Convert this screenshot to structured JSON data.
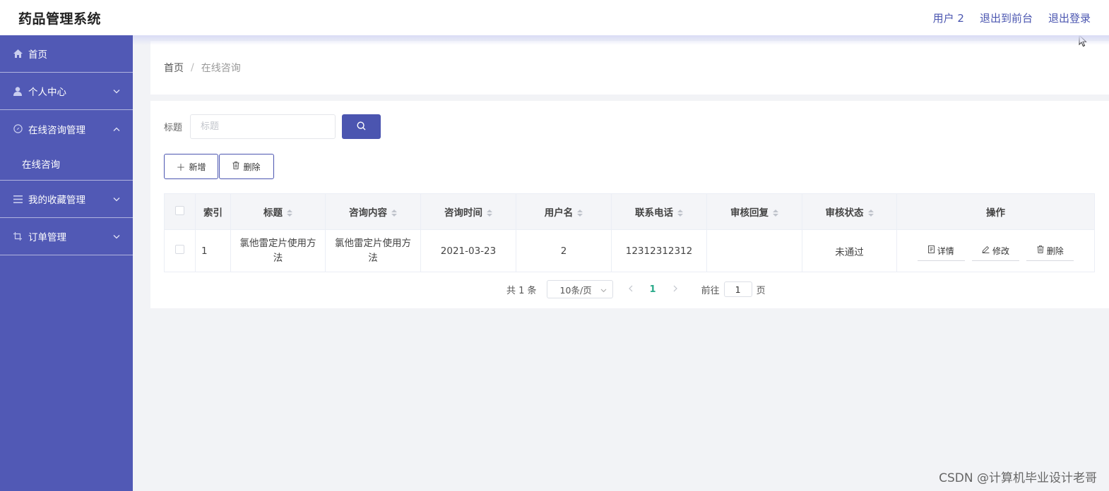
{
  "header": {
    "title": "药品管理系统",
    "user": "用户 2",
    "to_front": "退出到前台",
    "logout": "退出登录"
  },
  "sidebar": {
    "items": [
      {
        "label": "首页",
        "icon": "home-icon"
      },
      {
        "label": "个人中心",
        "icon": "user-icon"
      },
      {
        "label": "在线咨询管理",
        "icon": "compass-icon"
      },
      {
        "label": "在线咨询",
        "icon": ""
      },
      {
        "label": "我的收藏管理",
        "icon": "list-icon"
      },
      {
        "label": "订单管理",
        "icon": "crop-icon"
      }
    ]
  },
  "breadcrumb": {
    "home": "首页",
    "separator": "/",
    "current": "在线咨询"
  },
  "search": {
    "label": "标题",
    "placeholder": "标题"
  },
  "actions": {
    "add": "新增",
    "delete": "删除"
  },
  "table": {
    "columns": [
      "索引",
      "标题",
      "咨询内容",
      "咨询时间",
      "用户名",
      "联系电话",
      "审核回复",
      "审核状态",
      "操作"
    ],
    "rows": [
      {
        "index": "1",
        "title": "氯他雷定片使用方法",
        "content": "氯他雷定片使用方法",
        "time": "2021-03-23",
        "username": "2",
        "phone": "12312312312",
        "reply": "",
        "status": "未通过"
      }
    ],
    "row_ops": {
      "detail": "详情",
      "edit": "修改",
      "delete": "删除"
    }
  },
  "pager": {
    "total": "共 1 条",
    "page_size": "10条/页",
    "current_page": "1",
    "goto_label": "前往",
    "goto_value": "1",
    "page_suffix": "页"
  },
  "watermark": "CSDN @计算机毕业设计老哥",
  "colors": {
    "sidebar": "#5159b5",
    "accent": "#4b55b0",
    "active_page": "#2aaa8a"
  }
}
